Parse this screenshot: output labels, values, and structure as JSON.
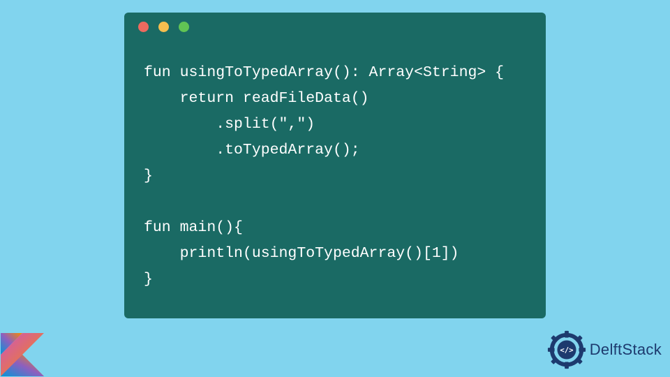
{
  "code": {
    "line1": "fun usingToTypedArray(): Array<String> {",
    "line2": "    return readFileData()",
    "line3": "        .split(\",\")",
    "line4": "        .toTypedArray();",
    "line5": "}",
    "line6": "",
    "line7": "fun main(){",
    "line8": "    println(usingToTypedArray()[1])",
    "line9": "}"
  },
  "branding": {
    "delft_label": "DelftStack"
  },
  "window": {
    "dots": [
      "close",
      "minimize",
      "zoom"
    ]
  }
}
